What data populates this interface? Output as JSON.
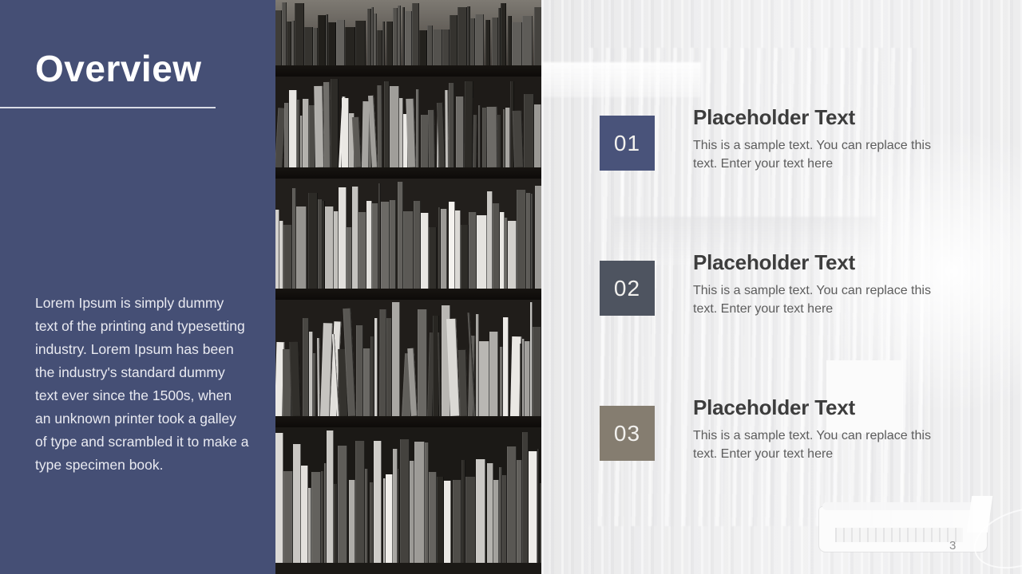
{
  "slide": {
    "title": "Overview",
    "page_number": "3",
    "colors": {
      "panel_navy": "#454F75",
      "accent_01": "#49537A",
      "accent_02": "#4E5460",
      "accent_03": "#857D70",
      "background_light": "#EBEBEC",
      "heading_text": "#3D3D3D",
      "body_text": "#5D5D5D"
    },
    "body_copy": "Lorem Ipsum is simply dummy text of the printing and typesetting industry. Lorem Ipsum has been the industry's standard dummy text ever since the 1500s,  when an unknown printer took a galley of type and scrambled it to make a type specimen book.",
    "photo": {
      "alt": "bookshelf-photo",
      "treatment": "grayscale"
    }
  },
  "items": [
    {
      "number": "01",
      "heading": "Placeholder Text",
      "body": "This is a sample text. You can replace this text. Enter your text here",
      "color": "#49537A"
    },
    {
      "number": "02",
      "heading": "Placeholder Text",
      "body": "This is a sample text. You can replace this text. Enter your text here",
      "color": "#4E5460"
    },
    {
      "number": "03",
      "heading": "Placeholder Text",
      "body": "This is a sample text. You can replace this text. Enter your text here",
      "color": "#857D70"
    }
  ]
}
